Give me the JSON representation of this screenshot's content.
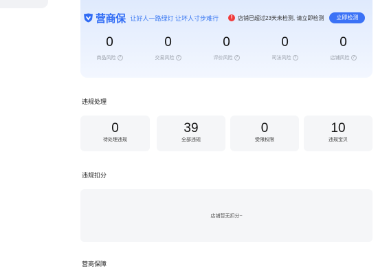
{
  "colors": {
    "accent": "#3b72f6",
    "brand": "#2f6bf5",
    "warning": "#f03b3b"
  },
  "brand": {
    "name": "营商保",
    "slogan": "让好人一路绿灯 让坏人寸步难行",
    "warning_text": "店铺已超过23天未检测, 请立即检测",
    "warning_icon": "!",
    "check_button": "立即检测"
  },
  "risk_metrics": [
    {
      "value": "0",
      "label": "商品风险"
    },
    {
      "value": "0",
      "label": "交易风险"
    },
    {
      "value": "0",
      "label": "评价风险"
    },
    {
      "value": "0",
      "label": "司法风险"
    },
    {
      "value": "0",
      "label": "店铺风险"
    }
  ],
  "help_icon_glyph": "?",
  "violation_section": {
    "title": "违规处理",
    "cards": [
      {
        "value": "0",
        "label": "待处理违规"
      },
      {
        "value": "39",
        "label": "全部违规"
      },
      {
        "value": "0",
        "label": "受限权限"
      },
      {
        "value": "10",
        "label": "违规宝贝"
      }
    ]
  },
  "deduction_section": {
    "title": "违规扣分",
    "empty_text": "店铺暂无扣分~"
  },
  "guarantee_section": {
    "title": "营商保障"
  }
}
